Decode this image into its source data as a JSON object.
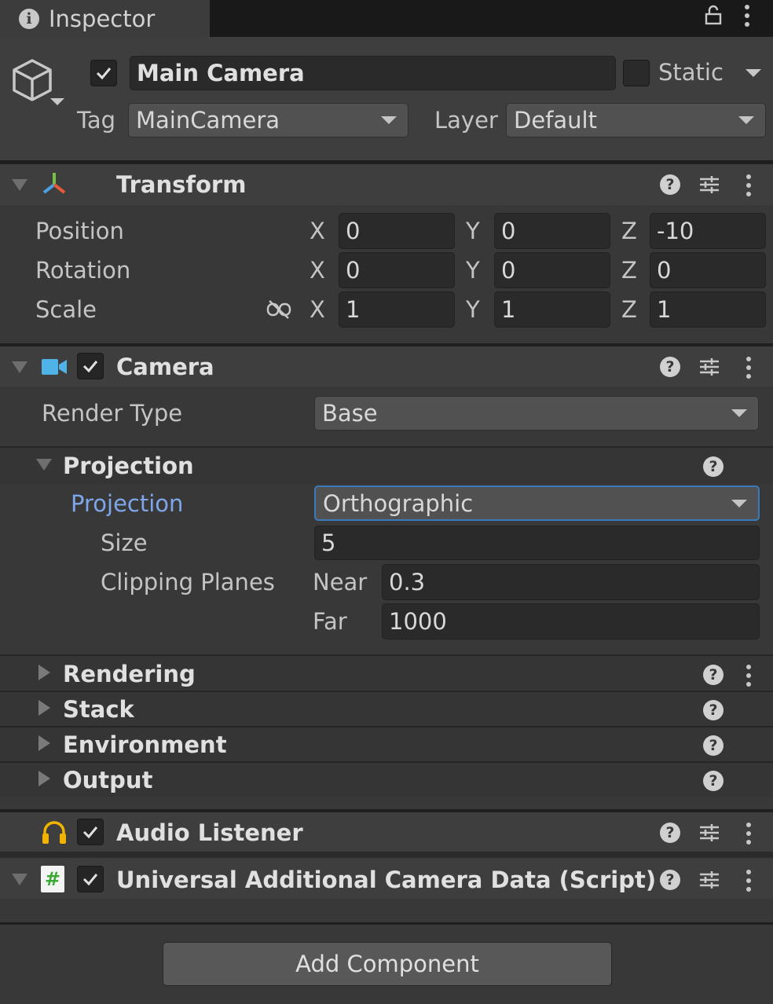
{
  "tab": {
    "title": "Inspector"
  },
  "gameobject": {
    "name": "Main Camera",
    "static_label": "Static",
    "tag_label": "Tag",
    "tag_value": "MainCamera",
    "layer_label": "Layer",
    "layer_value": "Default"
  },
  "transform": {
    "title": "Transform",
    "rows": [
      {
        "label": "Position",
        "x": "0",
        "y": "0",
        "z": "-10"
      },
      {
        "label": "Rotation",
        "x": "0",
        "y": "0",
        "z": "0"
      },
      {
        "label": "Scale",
        "x": "1",
        "y": "1",
        "z": "1"
      }
    ],
    "axis_x": "X",
    "axis_y": "Y",
    "axis_z": "Z"
  },
  "camera": {
    "title": "Camera",
    "render_type_label": "Render Type",
    "render_type_value": "Base",
    "projection_section": "Projection",
    "projection_label": "Projection",
    "projection_value": "Orthographic",
    "size_label": "Size",
    "size_value": "5",
    "clipping_label": "Clipping Planes",
    "near_label": "Near",
    "near_value": "0.3",
    "far_label": "Far",
    "far_value": "1000",
    "sections": [
      "Rendering",
      "Stack",
      "Environment",
      "Output"
    ]
  },
  "audio_listener": {
    "title": "Audio Listener"
  },
  "script_component": {
    "title": "Universal Additional Camera Data (Script)",
    "icon_glyph": "#"
  },
  "add_component": "Add Component",
  "help_glyph": "?",
  "info_glyph": "i",
  "colors": {
    "accent_blue": "#7ea6e8",
    "focus_border": "#3a79bb",
    "audio_icon": "#f0b400",
    "camera_icon": "#4fb3e8",
    "script_icon": "#3aaa35"
  }
}
